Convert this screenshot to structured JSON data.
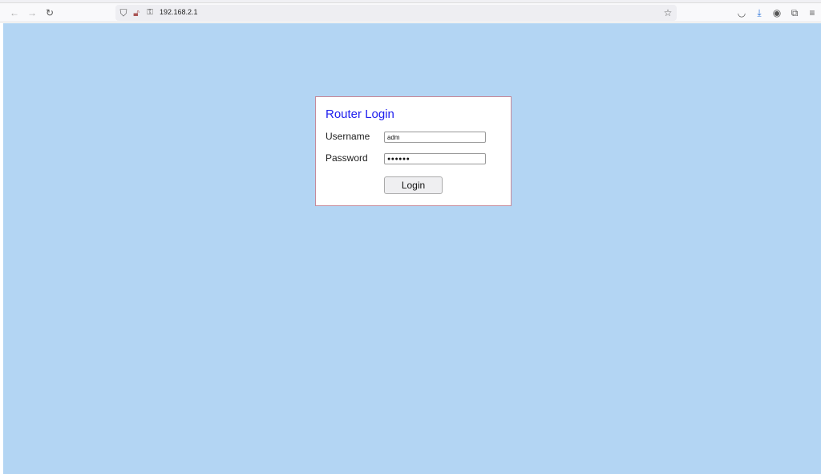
{
  "browser": {
    "url": "192.168.2.1",
    "icons": [
      "back-icon",
      "forward-icon",
      "reload-icon",
      "shield-icon",
      "insecure-lock-icon",
      "key-icon",
      "star-icon",
      "pocket-icon",
      "download-icon",
      "account-icon",
      "extensions-icon",
      "menu-icon"
    ]
  },
  "login": {
    "title": "Router Login",
    "username_label": "Username",
    "username_value": "adm",
    "password_label": "Password",
    "password_masked": "●●●●●●",
    "login_button": "Login"
  },
  "colors": {
    "background": "#b3d5f3",
    "title": "#2020ee",
    "card_border": "#c58a9a"
  }
}
